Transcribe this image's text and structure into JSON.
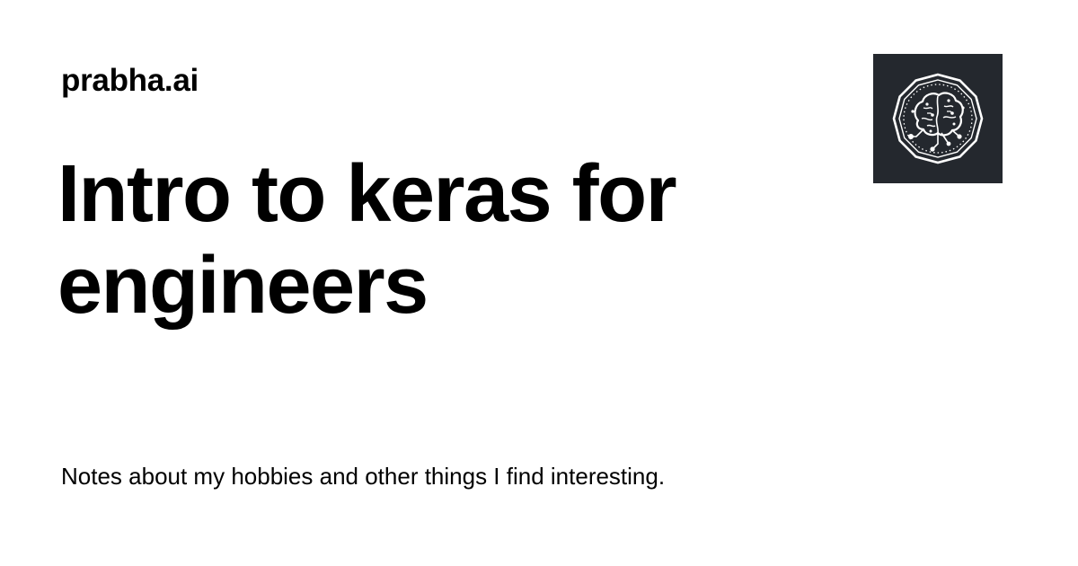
{
  "site": {
    "name": "prabha.ai"
  },
  "post": {
    "title": "Intro to keras for engineers",
    "description": "Notes about my hobbies and other things I find interesting."
  },
  "logo": {
    "icon": "brain-circuit-icon",
    "background_color": "#24282e",
    "foreground_color": "#ffffff"
  }
}
